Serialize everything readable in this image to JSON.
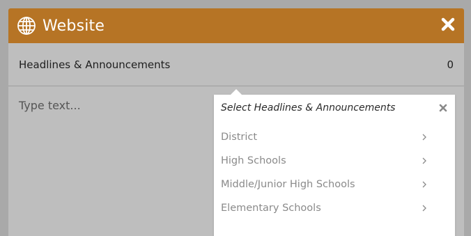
{
  "modal": {
    "title": "Website",
    "icon": "globe-icon",
    "close_icon": "close-icon",
    "header_color": "#b67425"
  },
  "row": {
    "label": "Headlines & Announcements",
    "count": "0"
  },
  "editor": {
    "placeholder": "Type text..."
  },
  "popup": {
    "title": "Select Headlines & Announcements",
    "items": [
      {
        "label": "District",
        "icon": "chevron-right-icon"
      },
      {
        "label": "High Schools",
        "icon": "chevron-right-icon"
      },
      {
        "label": "Middle/Junior High Schools",
        "icon": "chevron-right-icon"
      },
      {
        "label": "Elementary Schools",
        "icon": "chevron-right-icon"
      }
    ]
  }
}
